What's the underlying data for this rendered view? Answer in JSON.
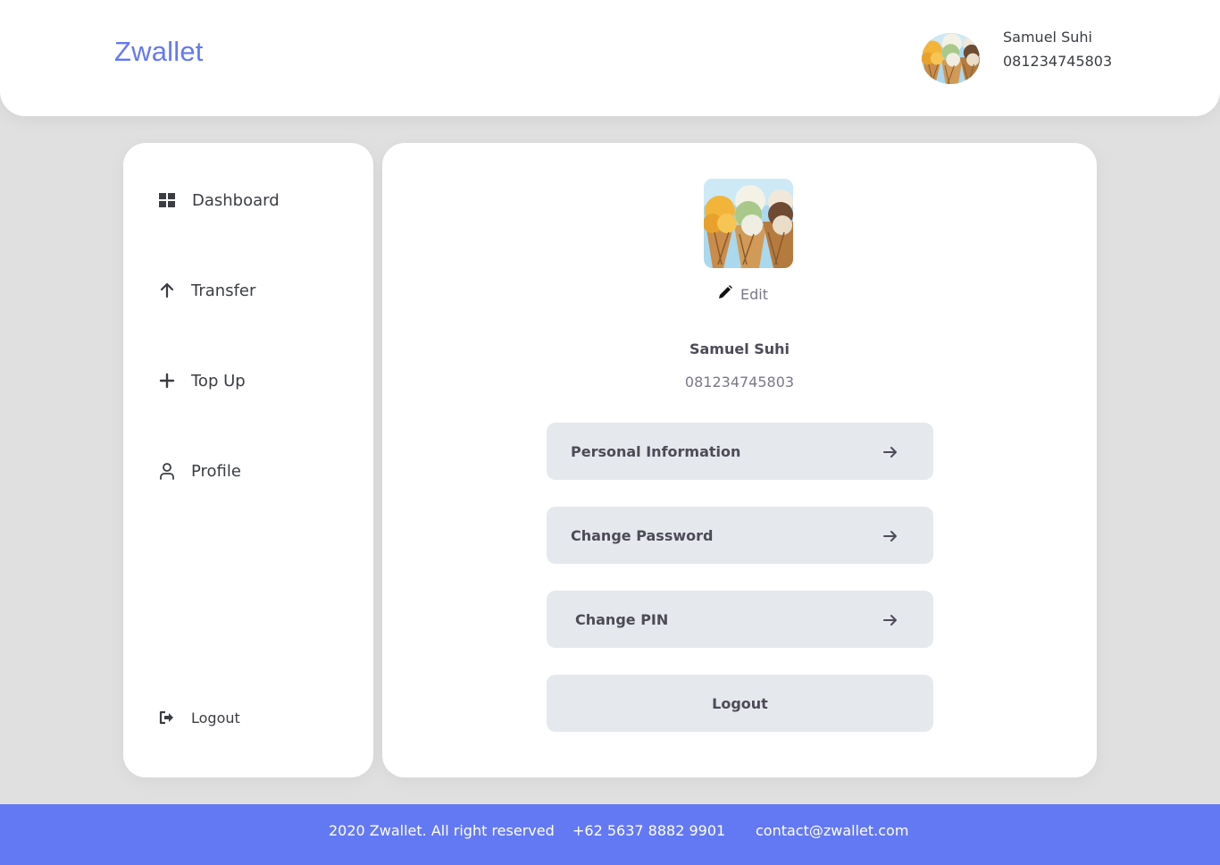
{
  "header": {
    "brand": "Zwallet",
    "user_name": "Samuel Suhi",
    "user_phone": "081234745803"
  },
  "sidebar": {
    "items": [
      {
        "label": "Dashboard",
        "icon": "grid-icon"
      },
      {
        "label": "Transfer",
        "icon": "arrow-up-icon"
      },
      {
        "label": "Top Up",
        "icon": "plus-icon"
      },
      {
        "label": "Profile",
        "icon": "user-icon"
      }
    ],
    "logout_label": "Logout",
    "logout_icon": "sign-out-icon"
  },
  "profile": {
    "edit_label": "Edit",
    "name": "Samuel Suhi",
    "phone": "081234745803",
    "menu": {
      "personal_info": "Personal Information",
      "change_password": "Change Password",
      "change_pin": "Change PIN",
      "logout": "Logout"
    }
  },
  "footer": {
    "copyright": "2020 Zwallet. All right reserved",
    "phone": "+62 5637 8882 9901",
    "email": "contact@zwallet.com"
  },
  "colors": {
    "accent": "#6379f4",
    "background": "#e0e0e0",
    "button_bg": "#e5e8ed"
  }
}
